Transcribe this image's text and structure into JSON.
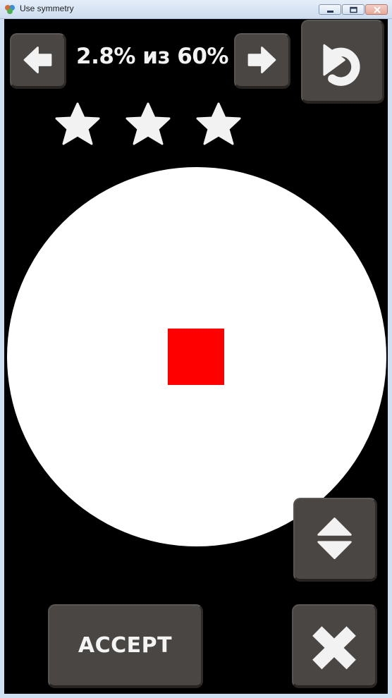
{
  "window": {
    "title": "Use symmetry",
    "controls": [
      "minimize",
      "maximize",
      "close"
    ]
  },
  "hud": {
    "progress_text": "2.8% из 60%",
    "progress_current_percent": 2.8,
    "progress_target_percent": 60,
    "stars_total": 3,
    "stars_earned": 0,
    "prev_icon": "arrow-left-icon",
    "next_icon": "arrow-right-icon",
    "reset_icon": "undo-icon"
  },
  "board": {
    "shape": "circle",
    "shape_color": "#ffffff",
    "piece_color": "#ff0000",
    "background_color": "#000000"
  },
  "controls": {
    "flip_icon": "flip-vertical-icon",
    "accept_label": "ACCEPT",
    "cancel_icon": "close-x-icon",
    "button_color": "#4a4644"
  }
}
